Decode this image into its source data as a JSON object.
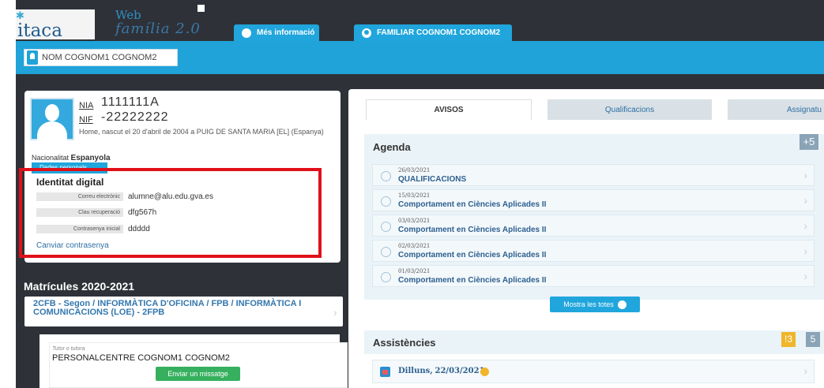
{
  "header": {
    "logo": "itaca",
    "app_line1": "Web",
    "app_line2": "família 2.0",
    "tab_info": "Més informació",
    "tab_user": "FAMILIAR COGNOM1 COGNOM2"
  },
  "student_chip": "NOM COGNOM1 COGNOM2",
  "profile": {
    "nia_label": "NIA",
    "nia_value": "1111111A",
    "nif_label": "NIF",
    "nif_value": "-22222222",
    "born": "Home, nascut el 20 d'abril de 2004 a PUIG DE SANTA MARIA [EL] (Espanya)",
    "nationality_label": "Nacionalitat",
    "nationality_value": "Espanyola",
    "fitxa_button": "Dades personals"
  },
  "identity": {
    "title": "Identitat digital",
    "rows": [
      {
        "label": "Correu electrònic",
        "value": "alumne@alu.edu.gva.es"
      },
      {
        "label": "Clau recuperació",
        "value": "dfg567h"
      },
      {
        "label": "Contrasenya inicial",
        "value": "ddddd"
      }
    ],
    "change_password": "Canviar contrasenya"
  },
  "enrolments": {
    "title": "Matrícules 2020-2021",
    "item": "2CFB - Segon / INFORMÀTICA D'OFICINA / FPB / INFORMÀTICA I COMUNICACIONS (LOE) - 2FPB"
  },
  "tutor": {
    "label": "Tutor o tutora",
    "name": "PERSONALCENTRE COGNOM1 COGNOM2",
    "button": "Enviar un missatge"
  },
  "tabs": [
    "AVISOS",
    "Qualificacions",
    "Assignatu"
  ],
  "agenda": {
    "title": "Agenda",
    "more": "+5",
    "items": [
      {
        "date": "26/03/2021",
        "text": "QUALIFICACIONS"
      },
      {
        "date": "15/03/2021",
        "text": "Comportament en Ciències Aplicades II"
      },
      {
        "date": "03/03/2021",
        "text": "Comportament en Ciències Aplicades II"
      },
      {
        "date": "02/03/2021",
        "text": "Comportament en Ciències Aplicades II"
      },
      {
        "date": "01/03/2021",
        "text": "Comportament en Ciències Aplicades II"
      }
    ],
    "show_all": "Mostra les totes"
  },
  "assist": {
    "title": "Assistències",
    "badge_warn": "!3",
    "badge_count": "5",
    "day_label": "Dilluns,",
    "day_date": "22/03/2021"
  },
  "colors": {
    "accent": "#1fa3d9",
    "dark": "#2e3238",
    "highlight": "#e0101a",
    "success": "#36b05e",
    "warning": "#f0b52a"
  }
}
